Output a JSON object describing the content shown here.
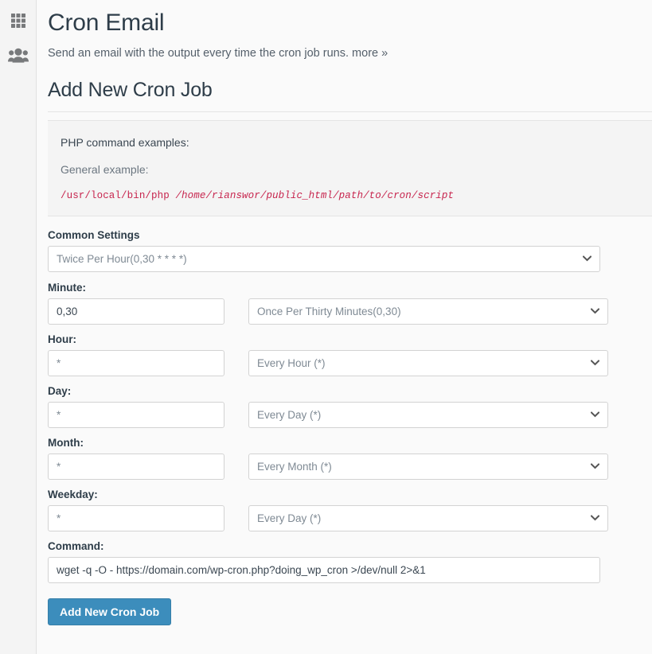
{
  "sidebar": {
    "items": [
      {
        "name": "apps-grid",
        "icon": "grid-icon",
        "label": "Apps"
      },
      {
        "name": "users",
        "icon": "users-icon",
        "label": "Users"
      }
    ]
  },
  "header": {
    "title": "Cron Email",
    "description": "Send an email with the output every time the cron job runs.",
    "more_link": "more »"
  },
  "section": {
    "title": "Add New Cron Job"
  },
  "examples": {
    "heading": "PHP command examples:",
    "subheading": "General example:",
    "code_binary": "/usr/local/bin/php",
    "code_path": "/home/rianswor/public_html/path/to/cron/script",
    "code_color": "#c7254e"
  },
  "form": {
    "common_settings": {
      "label": "Common Settings",
      "value": "Twice Per Hour(0,30 * * * *)"
    },
    "minute": {
      "label": "Minute:",
      "input_value": "0,30",
      "select_value": "Once Per Thirty Minutes(0,30)"
    },
    "hour": {
      "label": "Hour:",
      "input_value": "*",
      "select_value": "Every Hour (*)"
    },
    "day": {
      "label": "Day:",
      "input_value": "*",
      "select_value": "Every Day (*)"
    },
    "month": {
      "label": "Month:",
      "input_value": "*",
      "select_value": "Every Month (*)"
    },
    "weekday": {
      "label": "Weekday:",
      "input_value": "*",
      "select_value": "Every Day (*)"
    },
    "command": {
      "label": "Command:",
      "value": "wget -q -O - https://domain.com/wp-cron.php?doing_wp_cron >/dev/null 2>&1"
    },
    "submit_label": "Add New Cron Job",
    "accent_color": "#3c8dbc"
  }
}
